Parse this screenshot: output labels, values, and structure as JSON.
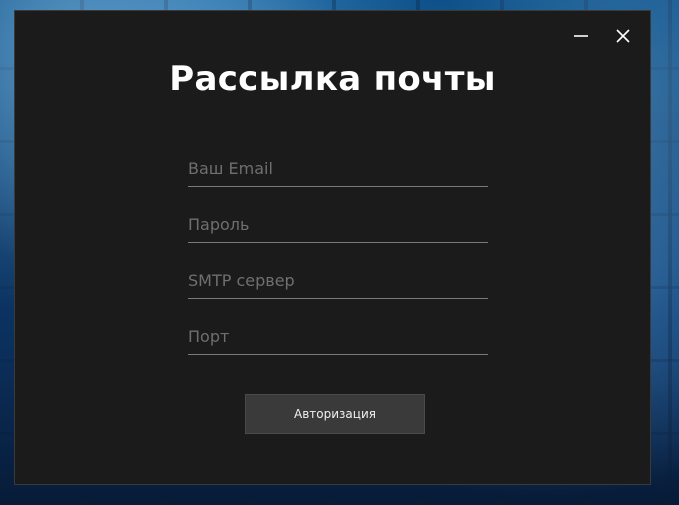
{
  "window": {
    "title": "Рассылка почты",
    "controls": {
      "minimize_icon": "minimize-icon",
      "close_icon": "close-icon"
    }
  },
  "form": {
    "email": {
      "value": "",
      "placeholder": "Ваш Email"
    },
    "password": {
      "value": "",
      "placeholder": "Пароль"
    },
    "smtp": {
      "value": "",
      "placeholder": "SMTP сервер"
    },
    "port": {
      "value": "",
      "placeholder": "Порт"
    }
  },
  "actions": {
    "auth_label": "Авторизация"
  },
  "colors": {
    "window_bg": "#1b1b1b",
    "title_text": "#ffffff",
    "input_line": "#7a7a7a",
    "placeholder": "#6f6f6f",
    "button_bg": "#3a3a3a",
    "button_text": "#f0f0f0"
  }
}
